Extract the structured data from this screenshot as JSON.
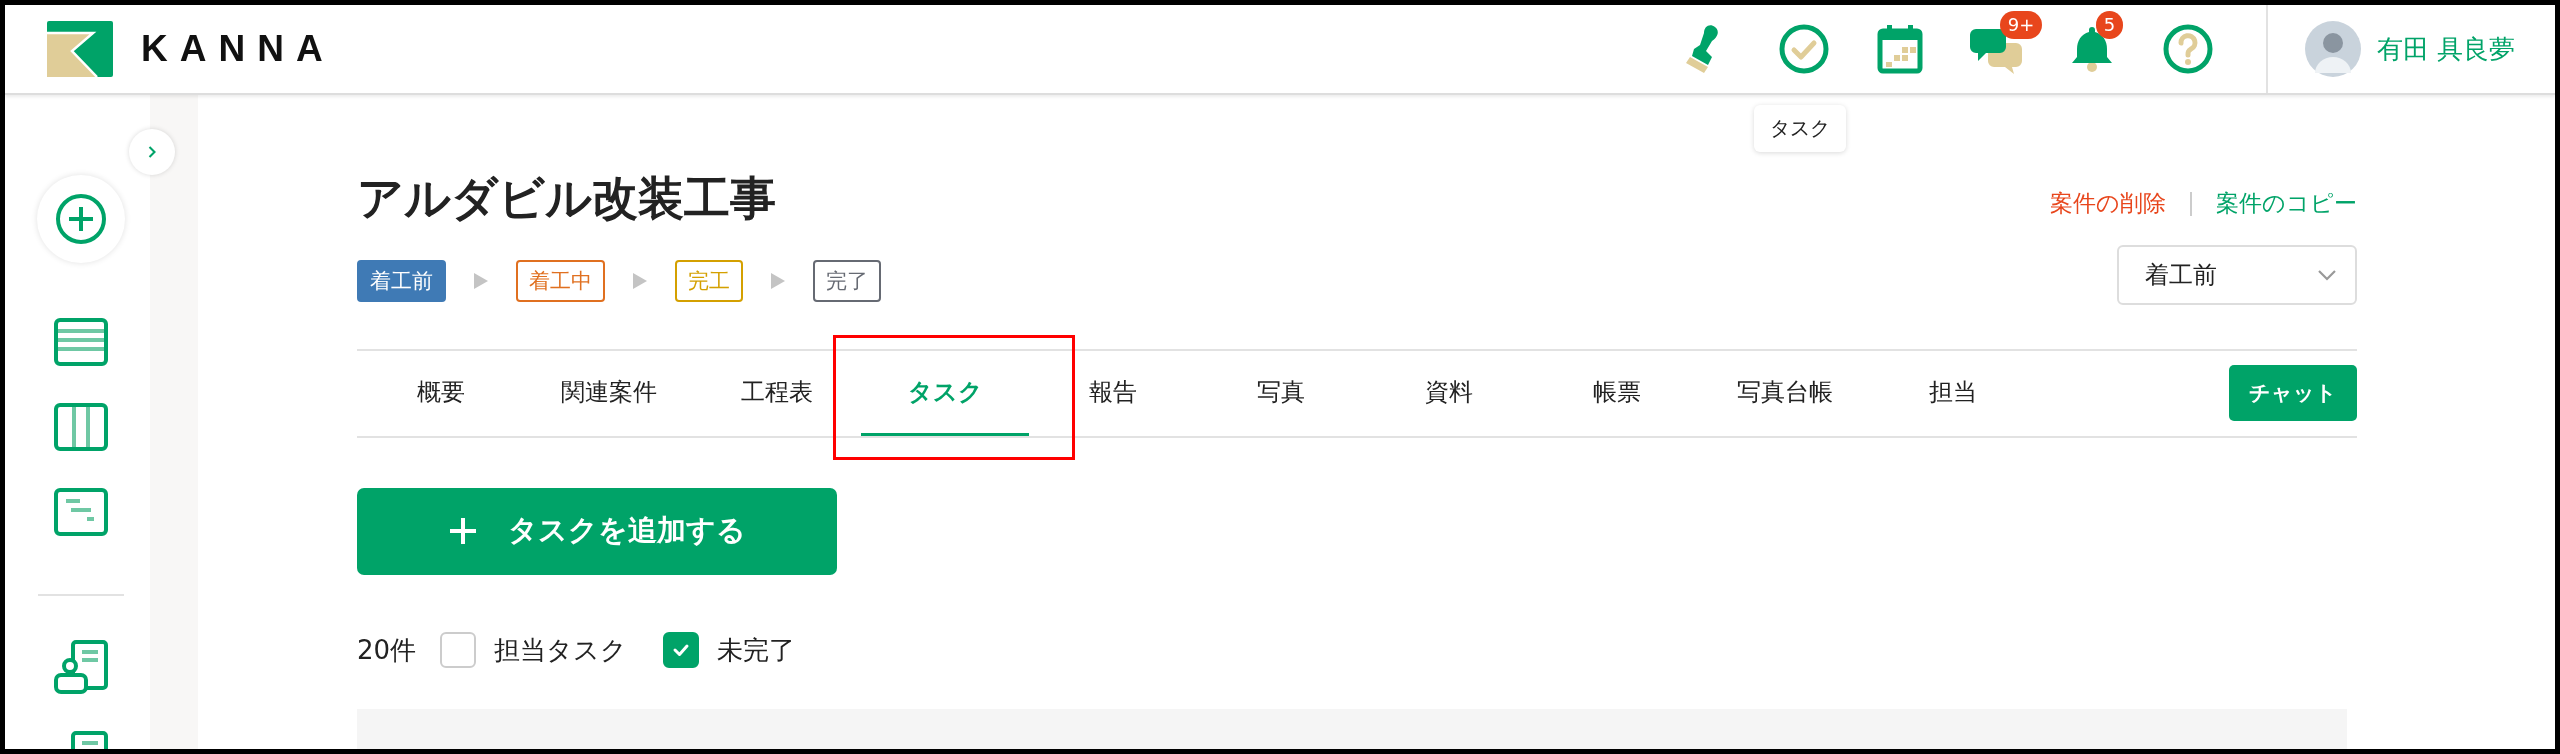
{
  "header": {
    "logo": "KANNA",
    "toolbar": [
      {
        "kind": "stamp"
      },
      {
        "kind": "task",
        "tooltip": "タスク"
      },
      {
        "kind": "calendar"
      },
      {
        "kind": "chat",
        "badge": "9+"
      },
      {
        "kind": "bell",
        "badge": "5"
      },
      {
        "kind": "help"
      }
    ],
    "user": {
      "name": "有田 具良夢"
    }
  },
  "sidebar": {
    "items": [
      {
        "kind": "add"
      },
      {
        "kind": "list"
      },
      {
        "kind": "board"
      },
      {
        "kind": "gantt"
      },
      {
        "kind": "divider"
      },
      {
        "kind": "customer"
      },
      {
        "kind": "customer"
      }
    ]
  },
  "project": {
    "title": "アルダビル改装工事",
    "statuses": [
      {
        "label": "着工前",
        "color": "#3f7ab5",
        "selected": true
      },
      {
        "label": "着工中",
        "color": "#e07020",
        "selected": false
      },
      {
        "label": "完工",
        "color": "#d4a000",
        "selected": false
      },
      {
        "label": "完了",
        "color": "#666a73",
        "selected": false
      }
    ],
    "actions": [
      {
        "label": "案件の削除",
        "kind": "danger"
      },
      {
        "label": "案件のコピー",
        "kind": "normal"
      }
    ],
    "status_select": {
      "value": "着工前"
    }
  },
  "tabs": [
    {
      "label": "概要",
      "selected": false,
      "highlighted": false
    },
    {
      "label": "関連案件",
      "selected": false,
      "highlighted": false
    },
    {
      "label": "工程表",
      "selected": false,
      "highlighted": false
    },
    {
      "label": "タスク",
      "selected": true,
      "highlighted": true
    },
    {
      "label": "報告",
      "selected": false,
      "highlighted": false
    },
    {
      "label": "写真",
      "selected": false,
      "highlighted": false
    },
    {
      "label": "資料",
      "selected": false,
      "highlighted": false
    },
    {
      "label": "帳票",
      "selected": false,
      "highlighted": false
    },
    {
      "label": "写真台帳",
      "selected": false,
      "highlighted": false
    },
    {
      "label": "担当",
      "selected": false,
      "highlighted": false
    }
  ],
  "chat_button": "チャット",
  "add_task_button": "タスクを追加する",
  "filters": {
    "count": "20件",
    "checkboxes": [
      {
        "label": "担当タスク",
        "checked": false
      },
      {
        "label": "未完了",
        "checked": true
      }
    ]
  }
}
